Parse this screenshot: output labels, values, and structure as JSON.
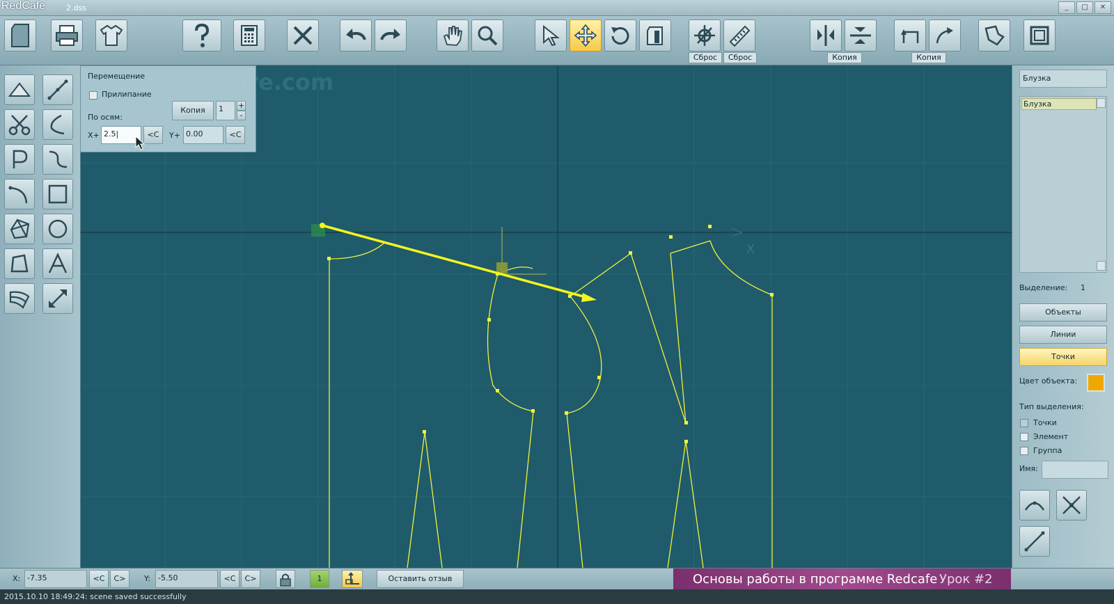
{
  "window": {
    "app_name": "RedCafe",
    "file_name": "2.dss"
  },
  "toolbar": {
    "labels": {
      "reset1": "Сброс",
      "reset2": "Сброс",
      "copy1": "Копия",
      "copy2": "Копия"
    }
  },
  "move_panel": {
    "title": "Перемещение",
    "snap_label": "Прилипание",
    "axes_label": "По осям:",
    "copy_button": "Копия",
    "copy_count": "1",
    "plus": "+",
    "minus": "-",
    "x_label": "X+",
    "x_value": "2.5|",
    "y_label": "Y+",
    "y_value": "0.00",
    "c_button": "<C"
  },
  "canvas": {
    "watermark": "RedCafeStore.com",
    "axis_x_label": "X",
    "line_color": "#f2f23a",
    "arrow_color": "#f5f51e"
  },
  "right_panel": {
    "header": "Блузка",
    "list_items": [
      "Блузка"
    ],
    "selection_label": "Выделение:",
    "selection_count": "1",
    "objects_button": "Объекты",
    "lines_button": "Линии",
    "points_button": "Точки",
    "color_label": "Цвет объекта:",
    "object_color": "#f0a800",
    "selection_type_label": "Тип выделения:",
    "type_points": "Точки",
    "type_element": "Элемент",
    "type_group": "Группа",
    "name_label": "Имя:"
  },
  "status": {
    "x_label": "X:",
    "x_value": "-7.35",
    "y_label": "Y:",
    "y_value": "-5.50",
    "prev": "<C",
    "next": "C>",
    "layer": "1",
    "feedback_button": "Оставить отзыв",
    "log": "2015.10.10 18:49:24: scene saved successfully"
  },
  "banner": {
    "title": "Основы работы в программе Redcafe",
    "lesson": "Урок #2"
  }
}
